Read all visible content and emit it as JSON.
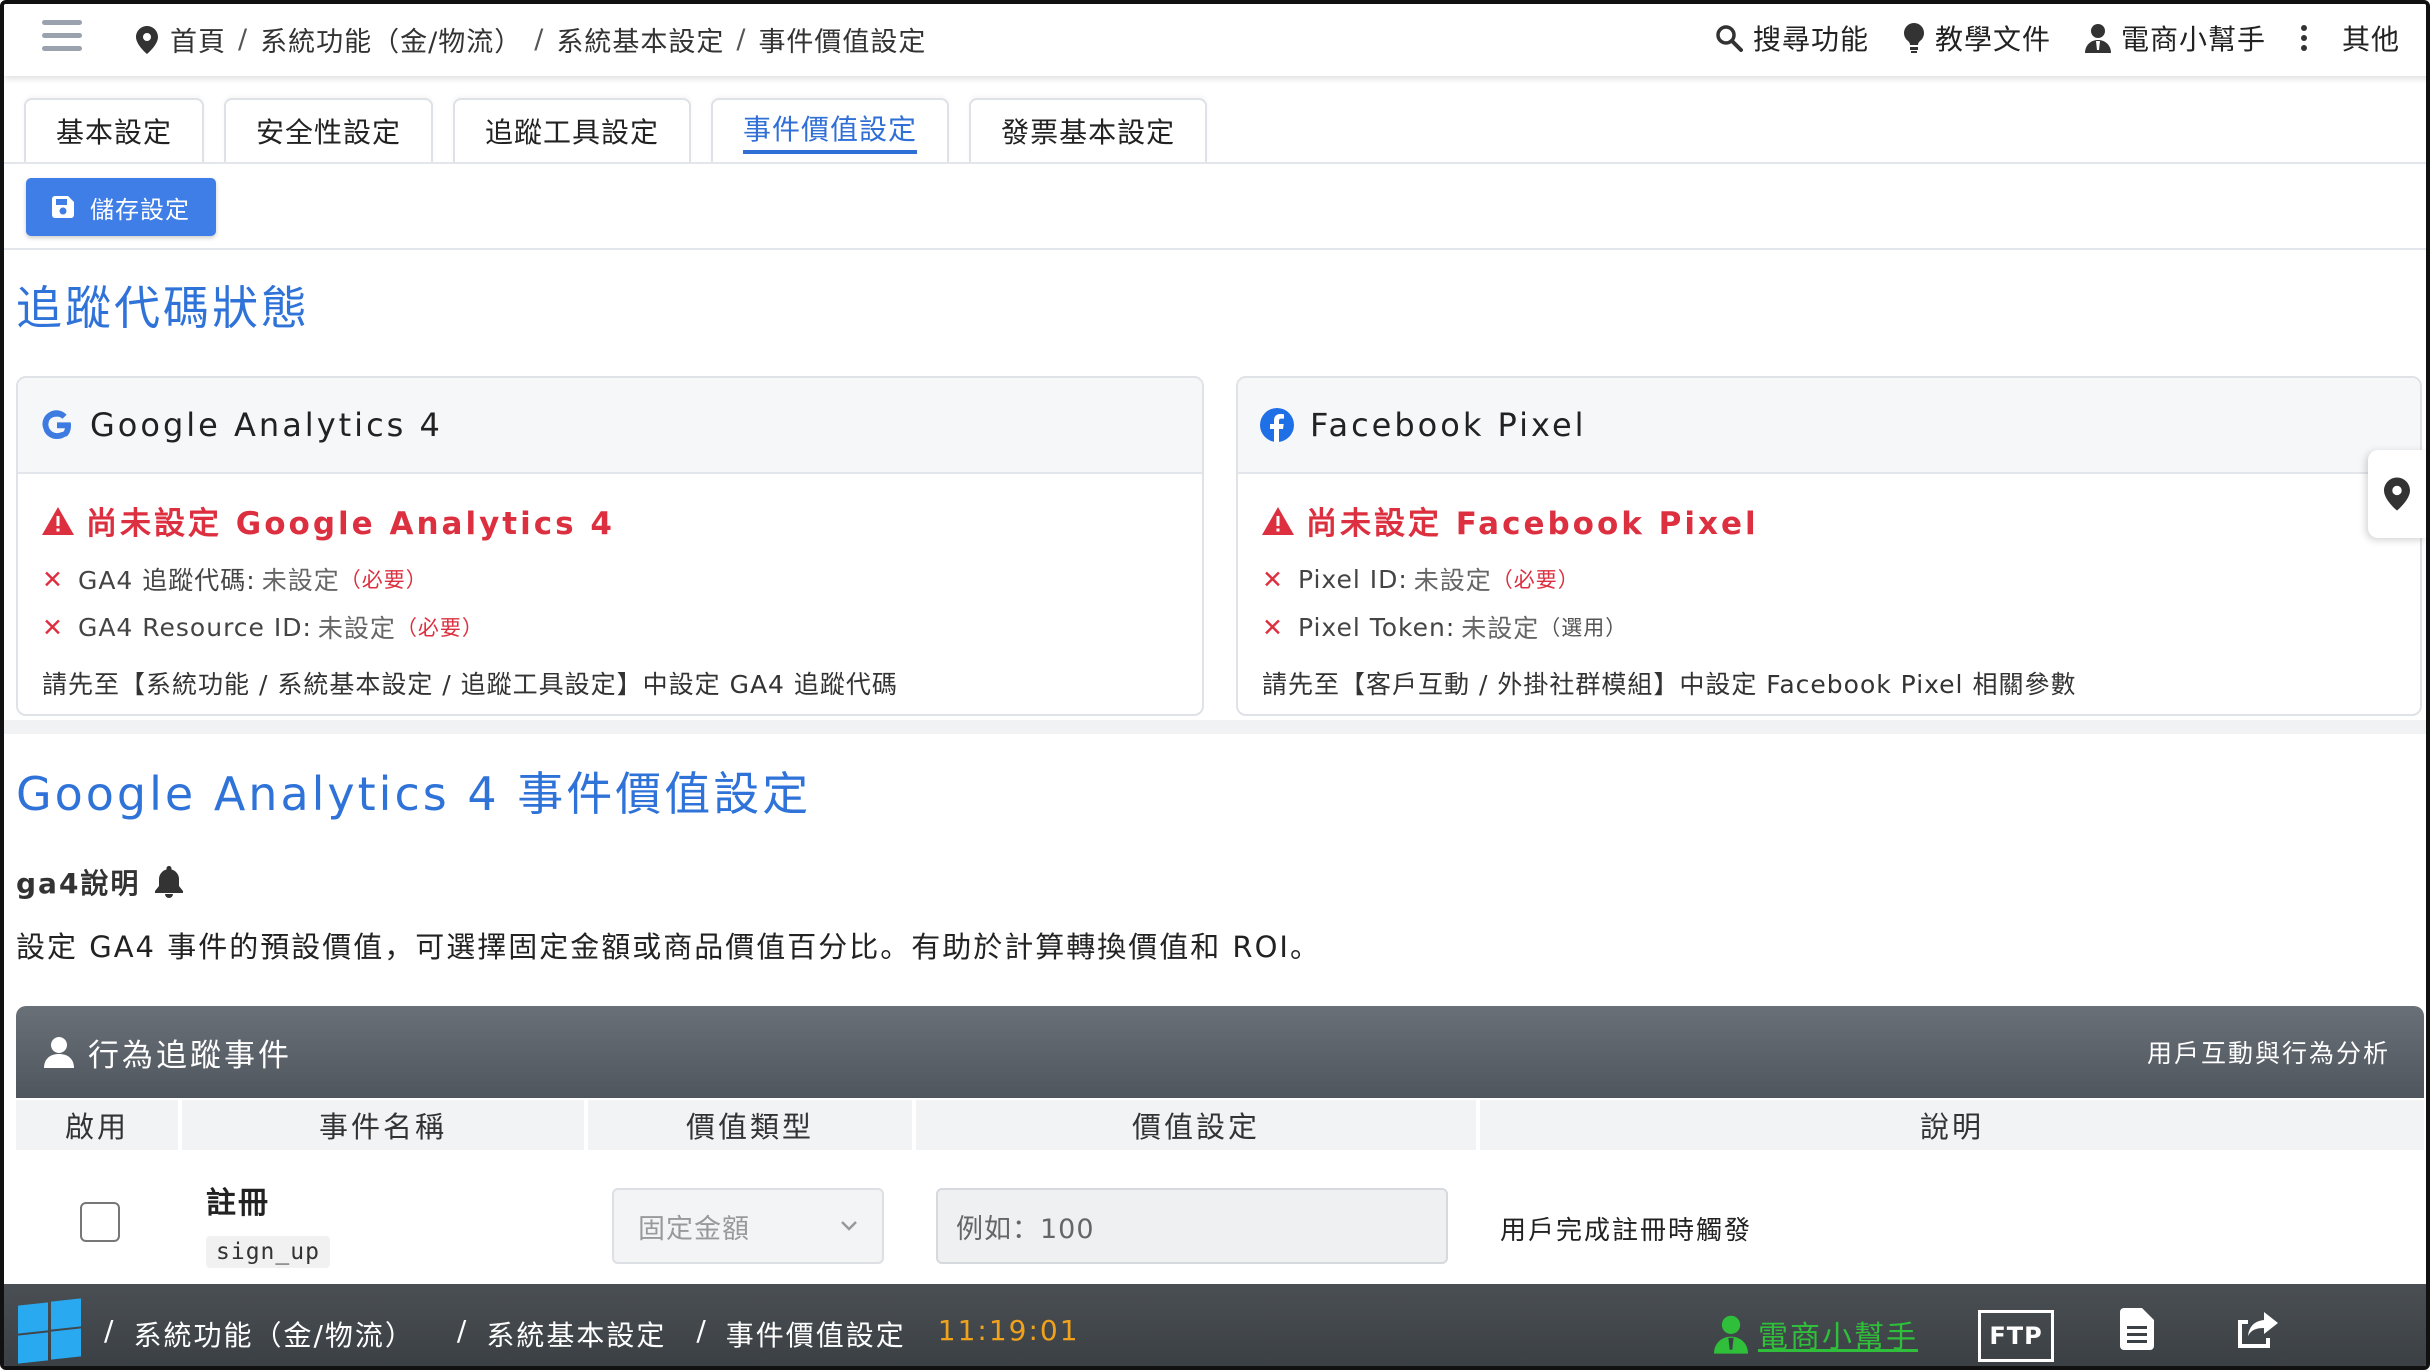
{
  "topbar": {
    "breadcrumb": [
      "首頁",
      "系統功能（金/物流）",
      "系統基本設定",
      "事件價值設定"
    ],
    "nav": {
      "search": "搜尋功能",
      "docs": "教學文件",
      "helper": "電商小幫手",
      "other": "其他"
    }
  },
  "tabs": [
    {
      "label": "基本設定"
    },
    {
      "label": "安全性設定"
    },
    {
      "label": "追蹤工具設定"
    },
    {
      "label": "事件價值設定"
    },
    {
      "label": "發票基本設定"
    }
  ],
  "save_button": "儲存設定",
  "tracking_status": {
    "title": "追蹤代碼狀態",
    "ga4": {
      "name": "Google Analytics 4",
      "warning": "尚未設定 Google Analytics 4",
      "items": [
        {
          "label": "GA4 追蹤代碼:",
          "status": "未設定",
          "tag": "（必要）"
        },
        {
          "label": "GA4 Resource ID:",
          "status": "未設定",
          "tag": "（必要）"
        }
      ],
      "hint": "請先至【系統功能 / 系統基本設定 / 追蹤工具設定】中設定 GA4 追蹤代碼"
    },
    "fb": {
      "name": "Facebook Pixel",
      "warning": "尚未設定 Facebook Pixel",
      "items": [
        {
          "label": "Pixel ID:",
          "status": "未設定",
          "tag": "（必要）"
        },
        {
          "label": "Pixel Token:",
          "status": "未設定",
          "tag": "（選用）"
        }
      ],
      "hint": "請先至【客戶互動 / 外掛社群模組】中設定 Facebook Pixel 相關參數"
    }
  },
  "ga4_section": {
    "title": "Google Analytics 4 事件價值設定",
    "note_title": "ga4說明",
    "description": "設定 GA4 事件的預設價值，可選擇固定金額或商品價值百分比。有助於計算轉換價值和 ROI。"
  },
  "events": {
    "group_title": "行為追蹤事件",
    "group_subtitle": "用戶互動與行為分析",
    "columns": [
      "啟用",
      "事件名稱",
      "價值類型",
      "價值設定",
      "說明"
    ],
    "rows": [
      {
        "enabled": false,
        "name": "註冊",
        "code": "sign_up",
        "value_type": "固定金額",
        "value_placeholder": "例如：100",
        "description": "用戶完成註冊時觸發"
      }
    ]
  },
  "taskbar": {
    "crumbs": [
      "/",
      "系統功能（金/物流）",
      "/",
      "系統基本設定",
      "/",
      "事件價值設定"
    ],
    "time": "11:19:01",
    "helper": "電商小幫手",
    "ftp": "FTP"
  },
  "colors": {
    "accent": "#2f73d9",
    "danger": "#dc3040",
    "taskbar_green": "#2fbf3a",
    "clock": "#f0a21c"
  }
}
